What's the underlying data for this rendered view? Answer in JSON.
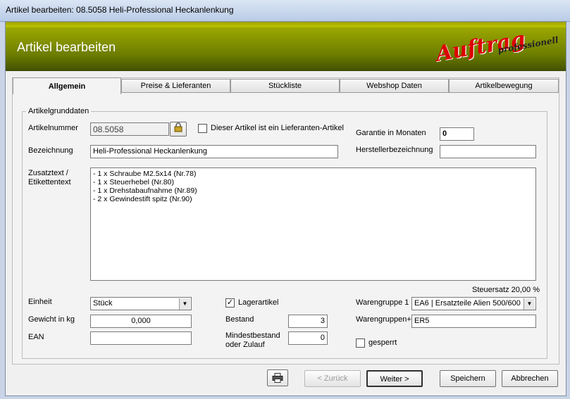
{
  "window": {
    "title": "Artikel bearbeiten: 08.5058 Heli-Professional Heckanlenkung"
  },
  "header": {
    "title": "Artikel bearbeiten",
    "logo_main": "Auftrag",
    "logo_sub": "professionell"
  },
  "tabs": [
    "Allgemein",
    "Preise & Lieferanten",
    "Stückliste",
    "Webshop Daten",
    "Artikelbewegung"
  ],
  "group": {
    "title": "Artikelgrunddaten"
  },
  "fields": {
    "artikelnummer_label": "Artikelnummer",
    "artikelnummer_value": "08.5058",
    "lieferanten_label": "Dieser Artikel ist ein Lieferanten-Artikel",
    "garantie_label": "Garantie in Monaten",
    "garantie_value": "0",
    "bezeichnung_label": "Bezeichnung",
    "bezeichnung_value": "Heli-Professional Heckanlenkung",
    "hersteller_label": "Herstellerbezeichnung",
    "hersteller_value": "",
    "zusatz_label_1": "Zusatztext /",
    "zusatz_label_2": "Etikettentext",
    "zusatz_lines": [
      "- 1 x Schraube M2.5x14 (Nr.78)",
      "- 1 x Steuerhebel (Nr.80)",
      "- 1 x Drehstabaufnahme (Nr.89)",
      "- 2 x Gewindestift spitz (Nr.90)"
    ],
    "steuersatz": "Steuersatz 20,00 %",
    "einheit_label": "Einheit",
    "einheit_value": "Stück",
    "lagerartikel_label": "Lagerartikel",
    "warengruppe1_label": "Warengruppe 1",
    "warengruppe1_value": "EA6  | Ersatzteile Alien 500/600",
    "gewicht_label": "Gewicht in kg",
    "gewicht_value": "0,000",
    "bestand_label": "Bestand",
    "bestand_value": "3",
    "warengruppen_plus_label": "Warengruppen+",
    "warengruppen_plus_value": "ER5",
    "ean_label": "EAN",
    "ean_value": "",
    "mindest_label_1": "Mindestbestand",
    "mindest_label_2": "oder Zulauf",
    "mindest_value": "0",
    "gesperrt_label": "gesperrt"
  },
  "buttons": {
    "zurueck": "< Zurück",
    "weiter": "Weiter >",
    "speichern": "Speichern",
    "abbrechen": "Abbrechen"
  }
}
